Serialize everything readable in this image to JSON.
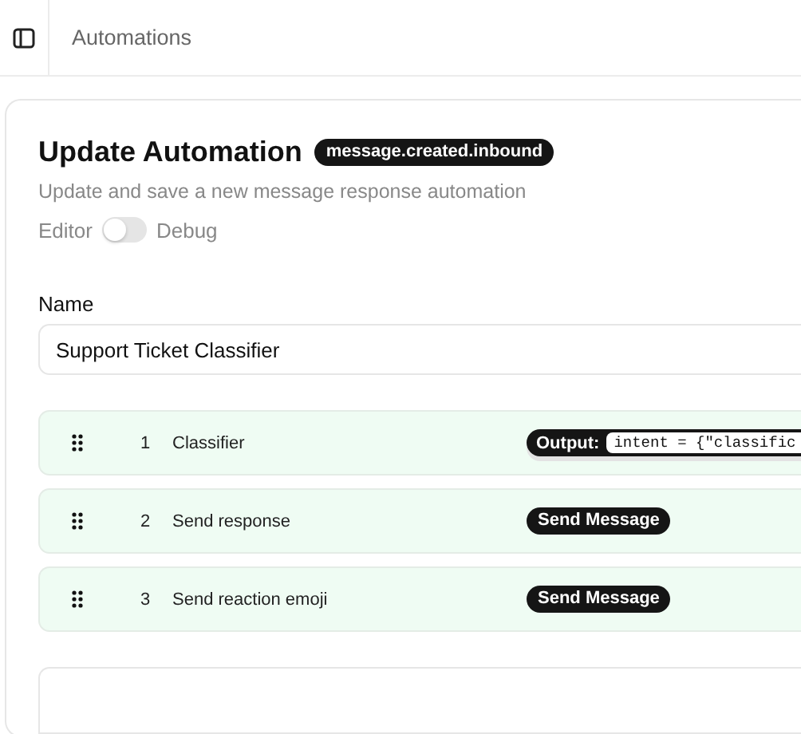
{
  "header": {
    "title": "Automations"
  },
  "card": {
    "title": "Update Automation",
    "event_badge": "message.created.inbound",
    "description": "Update and save a new message response automation",
    "mode_toggle": {
      "left_label": "Editor",
      "right_label": "Debug",
      "on": false
    },
    "name_field": {
      "label": "Name",
      "value": "Support Ticket Classifier"
    },
    "steps": [
      {
        "number": "1",
        "name": "Classifier",
        "kind": "output",
        "badge": "Output:",
        "code": "intent = {\"classific"
      },
      {
        "number": "2",
        "name": "Send response",
        "kind": "action",
        "badge": "Send Message"
      },
      {
        "number": "3",
        "name": "Send reaction emoji",
        "kind": "action",
        "badge": "Send Message"
      }
    ]
  }
}
